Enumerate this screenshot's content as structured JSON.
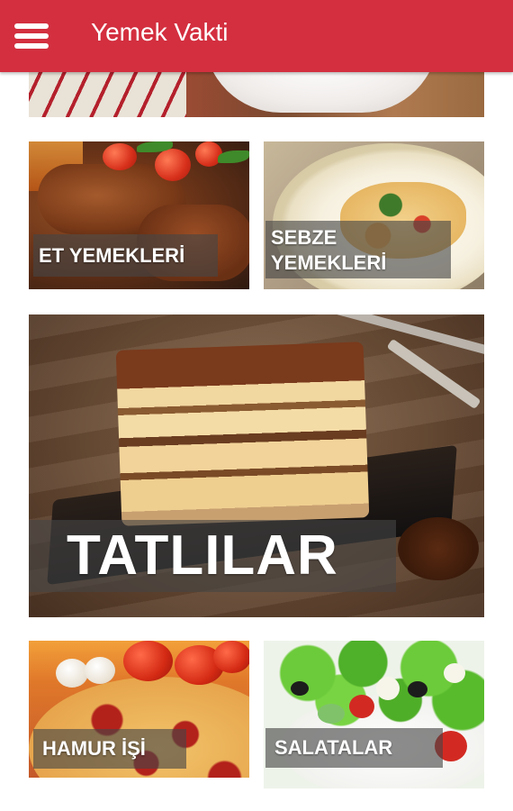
{
  "app": {
    "title": "Yemek Vakti",
    "menu_icon": "hamburger-menu-icon"
  },
  "categories": [
    {
      "label": "ET YEMEKLERİ"
    },
    {
      "label_line1": "SEBZE",
      "label_line2": "YEMEKLERİ"
    },
    {
      "label": "TATLILAR"
    },
    {
      "label": "HAMUR İŞİ"
    },
    {
      "label": "SALATALAR"
    }
  ],
  "colors": {
    "app_bar": "#d32f3f",
    "label_text": "#ffffff",
    "label_bg": "rgba(70,70,70,0.62)"
  }
}
